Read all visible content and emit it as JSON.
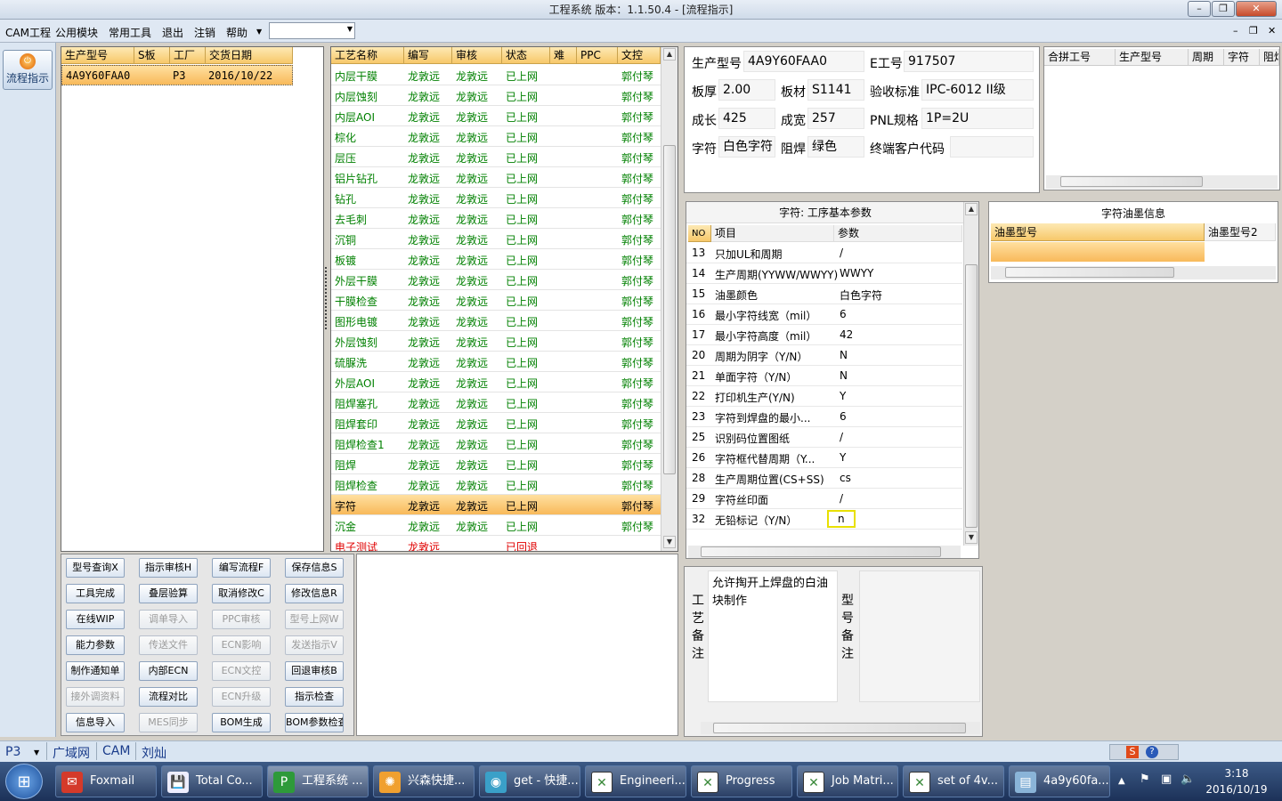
{
  "window": {
    "title": "工程系统   版本：1.1.50.4 - [流程指示]",
    "minimize": "–",
    "restore": "❐",
    "close": "✕"
  },
  "menu": {
    "items": [
      "CAM工程",
      "公用模块",
      "常用工具",
      "退出",
      "注销",
      "帮助"
    ],
    "combo_value": "",
    "mdi_controls": [
      "–",
      "❐",
      "✕"
    ]
  },
  "leftnav": {
    "flow_label": "流程指示"
  },
  "orders": {
    "headers": [
      "生产型号",
      "S板",
      "工厂",
      "交货日期"
    ],
    "rows": [
      {
        "model": "4A9Y60FAA0",
        "s": "",
        "factory": "P3",
        "date": "2016/10/22"
      }
    ]
  },
  "process": {
    "headers": [
      "工艺名称",
      "编写",
      "审核",
      "状态",
      "难",
      "PPC",
      "文控"
    ],
    "rows": [
      {
        "name": "内层干膜",
        "writer": "龙敦远",
        "reviewer": "龙敦远",
        "status": "已上网",
        "hard": "",
        "ppc": "",
        "doc": "郭付琴"
      },
      {
        "name": "内层蚀刻",
        "writer": "龙敦远",
        "reviewer": "龙敦远",
        "status": "已上网",
        "hard": "",
        "ppc": "",
        "doc": "郭付琴"
      },
      {
        "name": "内层AOI",
        "writer": "龙敦远",
        "reviewer": "龙敦远",
        "status": "已上网",
        "hard": "",
        "ppc": "",
        "doc": "郭付琴"
      },
      {
        "name": "棕化",
        "writer": "龙敦远",
        "reviewer": "龙敦远",
        "status": "已上网",
        "hard": "",
        "ppc": "",
        "doc": "郭付琴"
      },
      {
        "name": "层压",
        "writer": "龙敦远",
        "reviewer": "龙敦远",
        "status": "已上网",
        "hard": "",
        "ppc": "",
        "doc": "郭付琴"
      },
      {
        "name": "铝片钻孔",
        "writer": "龙敦远",
        "reviewer": "龙敦远",
        "status": "已上网",
        "hard": "",
        "ppc": "",
        "doc": "郭付琴"
      },
      {
        "name": "钻孔",
        "writer": "龙敦远",
        "reviewer": "龙敦远",
        "status": "已上网",
        "hard": "",
        "ppc": "",
        "doc": "郭付琴"
      },
      {
        "name": "去毛刺",
        "writer": "龙敦远",
        "reviewer": "龙敦远",
        "status": "已上网",
        "hard": "",
        "ppc": "",
        "doc": "郭付琴"
      },
      {
        "name": "沉铜",
        "writer": "龙敦远",
        "reviewer": "龙敦远",
        "status": "已上网",
        "hard": "",
        "ppc": "",
        "doc": "郭付琴"
      },
      {
        "name": "板镀",
        "writer": "龙敦远",
        "reviewer": "龙敦远",
        "status": "已上网",
        "hard": "",
        "ppc": "",
        "doc": "郭付琴"
      },
      {
        "name": "外层干膜",
        "writer": "龙敦远",
        "reviewer": "龙敦远",
        "status": "已上网",
        "hard": "",
        "ppc": "",
        "doc": "郭付琴"
      },
      {
        "name": "干膜检查",
        "writer": "龙敦远",
        "reviewer": "龙敦远",
        "status": "已上网",
        "hard": "",
        "ppc": "",
        "doc": "郭付琴"
      },
      {
        "name": "图形电镀",
        "writer": "龙敦远",
        "reviewer": "龙敦远",
        "status": "已上网",
        "hard": "",
        "ppc": "",
        "doc": "郭付琴"
      },
      {
        "name": "外层蚀刻",
        "writer": "龙敦远",
        "reviewer": "龙敦远",
        "status": "已上网",
        "hard": "",
        "ppc": "",
        "doc": "郭付琴"
      },
      {
        "name": "硫脲洗",
        "writer": "龙敦远",
        "reviewer": "龙敦远",
        "status": "已上网",
        "hard": "",
        "ppc": "",
        "doc": "郭付琴"
      },
      {
        "name": "外层AOI",
        "writer": "龙敦远",
        "reviewer": "龙敦远",
        "status": "已上网",
        "hard": "",
        "ppc": "",
        "doc": "郭付琴"
      },
      {
        "name": "阻焊塞孔",
        "writer": "龙敦远",
        "reviewer": "龙敦远",
        "status": "已上网",
        "hard": "",
        "ppc": "",
        "doc": "郭付琴"
      },
      {
        "name": "阻焊套印",
        "writer": "龙敦远",
        "reviewer": "龙敦远",
        "status": "已上网",
        "hard": "",
        "ppc": "",
        "doc": "郭付琴"
      },
      {
        "name": "阻焊检查1",
        "writer": "龙敦远",
        "reviewer": "龙敦远",
        "status": "已上网",
        "hard": "",
        "ppc": "",
        "doc": "郭付琴"
      },
      {
        "name": "阻焊",
        "writer": "龙敦远",
        "reviewer": "龙敦远",
        "status": "已上网",
        "hard": "",
        "ppc": "",
        "doc": "郭付琴"
      },
      {
        "name": "阻焊检查",
        "writer": "龙敦远",
        "reviewer": "龙敦远",
        "status": "已上网",
        "hard": "",
        "ppc": "",
        "doc": "郭付琴"
      },
      {
        "name": "字符",
        "writer": "龙敦远",
        "reviewer": "龙敦远",
        "status": "已上网",
        "hard": "",
        "ppc": "",
        "doc": "郭付琴"
      },
      {
        "name": "沉金",
        "writer": "龙敦远",
        "reviewer": "龙敦远",
        "status": "已上网",
        "hard": "",
        "ppc": "",
        "doc": "郭付琴"
      },
      {
        "name": "电子测试",
        "writer": "龙敦远",
        "reviewer": "",
        "status": "已回退",
        "hard": "",
        "ppc": "",
        "doc": ""
      }
    ],
    "selected_index": 21
  },
  "functions": [
    {
      "label": "型号查询X",
      "enabled": true
    },
    {
      "label": "指示审核H",
      "enabled": true
    },
    {
      "label": "编写流程F",
      "enabled": true
    },
    {
      "label": "保存信息S",
      "enabled": true
    },
    {
      "label": "工具完成",
      "enabled": true
    },
    {
      "label": "叠层验算",
      "enabled": true
    },
    {
      "label": "取消修改C",
      "enabled": true
    },
    {
      "label": "修改信息R",
      "enabled": true
    },
    {
      "label": "在线WIP",
      "enabled": true
    },
    {
      "label": "调单导入",
      "enabled": false
    },
    {
      "label": "PPC审核",
      "enabled": false
    },
    {
      "label": "型号上网W",
      "enabled": false
    },
    {
      "label": "能力参数",
      "enabled": true
    },
    {
      "label": "传送文件",
      "enabled": false
    },
    {
      "label": "ECN影响",
      "enabled": false
    },
    {
      "label": "发送指示V",
      "enabled": false
    },
    {
      "label": "制作通知单",
      "enabled": true
    },
    {
      "label": "内部ECN",
      "enabled": true
    },
    {
      "label": "ECN文控",
      "enabled": false
    },
    {
      "label": "回退审核B",
      "enabled": true
    },
    {
      "label": "接外调资料",
      "enabled": false
    },
    {
      "label": "流程对比",
      "enabled": true
    },
    {
      "label": "ECN升级",
      "enabled": false
    },
    {
      "label": "指示检查",
      "enabled": true
    },
    {
      "label": "信息导入",
      "enabled": true
    },
    {
      "label": "MES同步",
      "enabled": false
    },
    {
      "label": "BOM生成",
      "enabled": true
    },
    {
      "label": "BOM参数检查",
      "enabled": true
    }
  ],
  "info": {
    "model_label": "生产型号",
    "model": "4A9Y60FAA0",
    "eno_label": "E工号",
    "eno": "917507",
    "thickness_label": "板厚",
    "thickness": "2.00",
    "material_label": "板材",
    "material": "S1141",
    "standard_label": "验收标准",
    "standard": "IPC-6012 II级",
    "length_label": "成长",
    "length": "425",
    "width_label": "成宽",
    "width": "257",
    "pnl_label": "PNL规格",
    "pnl": "1P=2U",
    "char_label": "字符",
    "char": "白色字符",
    "mask_label": "阻焊",
    "mask": "绿色",
    "customer_label": "终端客户代码",
    "customer": ""
  },
  "merge": {
    "headers": [
      "合拼工号",
      "生产型号",
      "周期",
      "字符",
      "阻焊"
    ]
  },
  "params": {
    "title": "字符: 工序基本参数",
    "headers": [
      "NO",
      "项目",
      "参数"
    ],
    "rows": [
      {
        "no": "13",
        "item": "只加UL和周期",
        "value": "/"
      },
      {
        "no": "14",
        "item": "生产周期(YYWW/WWYY)",
        "value": "WWYY"
      },
      {
        "no": "15",
        "item": "油墨颜色",
        "value": "白色字符"
      },
      {
        "no": "16",
        "item": "最小字符线宽（mil）",
        "value": "6"
      },
      {
        "no": "17",
        "item": "最小字符高度（mil）",
        "value": "42"
      },
      {
        "no": "20",
        "item": "周期为阴字（Y/N）",
        "value": "N"
      },
      {
        "no": "21",
        "item": "单面字符（Y/N）",
        "value": "N"
      },
      {
        "no": "22",
        "item": "打印机生产(Y/N)",
        "value": "Y"
      },
      {
        "no": "23",
        "item": "字符到焊盘的最小...",
        "value": "6"
      },
      {
        "no": "25",
        "item": "识别码位置图纸",
        "value": "/"
      },
      {
        "no": "26",
        "item": "字符框代替周期（Y...",
        "value": "Y"
      },
      {
        "no": "28",
        "item": "生产周期位置(CS+SS)",
        "value": "cs"
      },
      {
        "no": "29",
        "item": "字符丝印面",
        "value": "/"
      },
      {
        "no": "32",
        "item": "无铅标记（Y/N）",
        "value": "n"
      }
    ]
  },
  "ink": {
    "title": "字符油墨信息",
    "headers": [
      "油墨型号",
      "油墨型号2"
    ]
  },
  "notes": {
    "process_label": "工艺备注",
    "process_text": "允许掏开上焊盘的白油块制作",
    "model_label": "型号备注",
    "model_text": ""
  },
  "statusbar": {
    "factory": "P3",
    "net": "广域网",
    "module": "CAM",
    "user": "刘灿"
  },
  "taskbar": {
    "items": [
      "Foxmail",
      "Total Co...",
      "工程系统 ...",
      "兴森快捷...",
      "get - 快捷...",
      "Engineeri...",
      "Progress",
      "Job Matri...",
      "set of 4v...",
      "4a9y60fa..."
    ],
    "time": "3:18",
    "date": "2016/10/19"
  },
  "colors": {
    "selected_row": "#f8b95a",
    "header": "#f7c86a",
    "green_text": "#008000",
    "red_text": "#e00000"
  }
}
